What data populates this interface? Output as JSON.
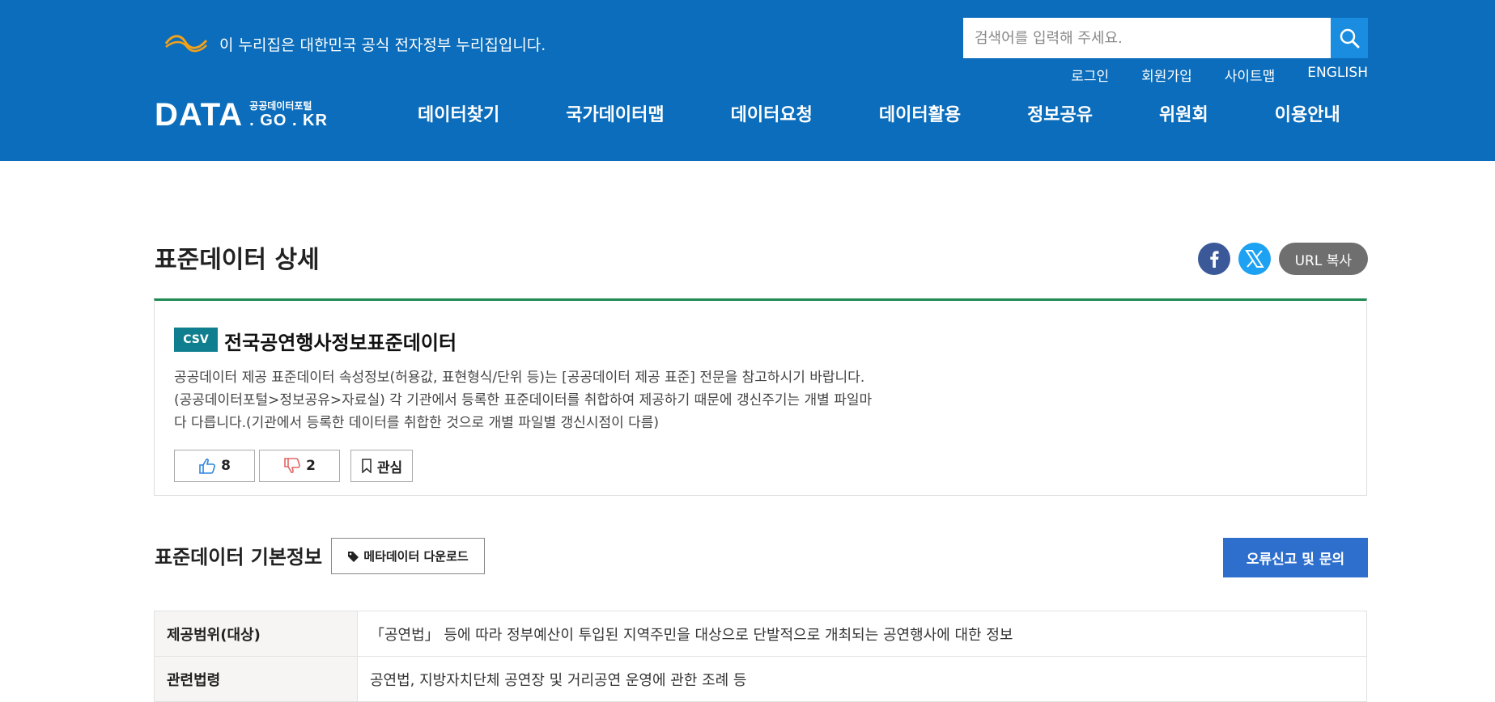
{
  "header": {
    "gov_notice": "이 누리집은 대한민국 공식 전자정부 누리집입니다.",
    "search_placeholder": "검색어를 입력해 주세요.",
    "util_links": [
      "로그인",
      "회원가입",
      "사이트맵",
      "ENGLISH"
    ],
    "logo_main": "DATA",
    "logo_sub_top": "공공데이터포털",
    "logo_sub_bottom": ". GO . KR",
    "nav": [
      "데이터찾기",
      "국가데이터맵",
      "데이터요청",
      "데이터활용",
      "정보공유",
      "위원회",
      "이용안내"
    ]
  },
  "page": {
    "title": "표준데이터 상세",
    "url_copy": "URL 복사"
  },
  "dataset": {
    "format_badge": "CSV",
    "title": "전국공연행사정보표준데이터",
    "description_lines": [
      "공공데이터 제공 표준데이터 속성정보(허용값, 표현형식/단위 등)는 [공공데이터 제공 표준] 전문을 참고하시기 바랍니다.",
      "(공공데이터포털>정보공유>자료실) 각 기관에서 등록한 표준데이터를 취합하여 제공하기 때문에 갱신주기는 개별 파일마",
      "다 다릅니다.(기관에서 등록한 데이터를 취합한 것으로 개별 파일별 갱신시점이 다름)"
    ],
    "likes": "8",
    "dislikes": "2",
    "favorite_label": "관심"
  },
  "basic_info": {
    "section_title": "표준데이터 기본정보",
    "meta_download": "메타데이터 다운로드",
    "error_report": "오류신고 및 문의",
    "rows": [
      {
        "label": "제공범위(대상)",
        "value": "「공연법」 등에 따라 정부예산이 투입된 지역주민을 대상으로 단발적으로 개최되는 공연행사에 대한 정보"
      },
      {
        "label": "관련법령",
        "value": "공연법, 지방자치단체 공연장 및 거리공연 운영에 관한 조례 등"
      }
    ]
  },
  "colors": {
    "header_bg": "#0b6dbb",
    "accent_green": "#1d8a53",
    "badge": "#0f7f8f",
    "error_button": "#2e6fce"
  }
}
